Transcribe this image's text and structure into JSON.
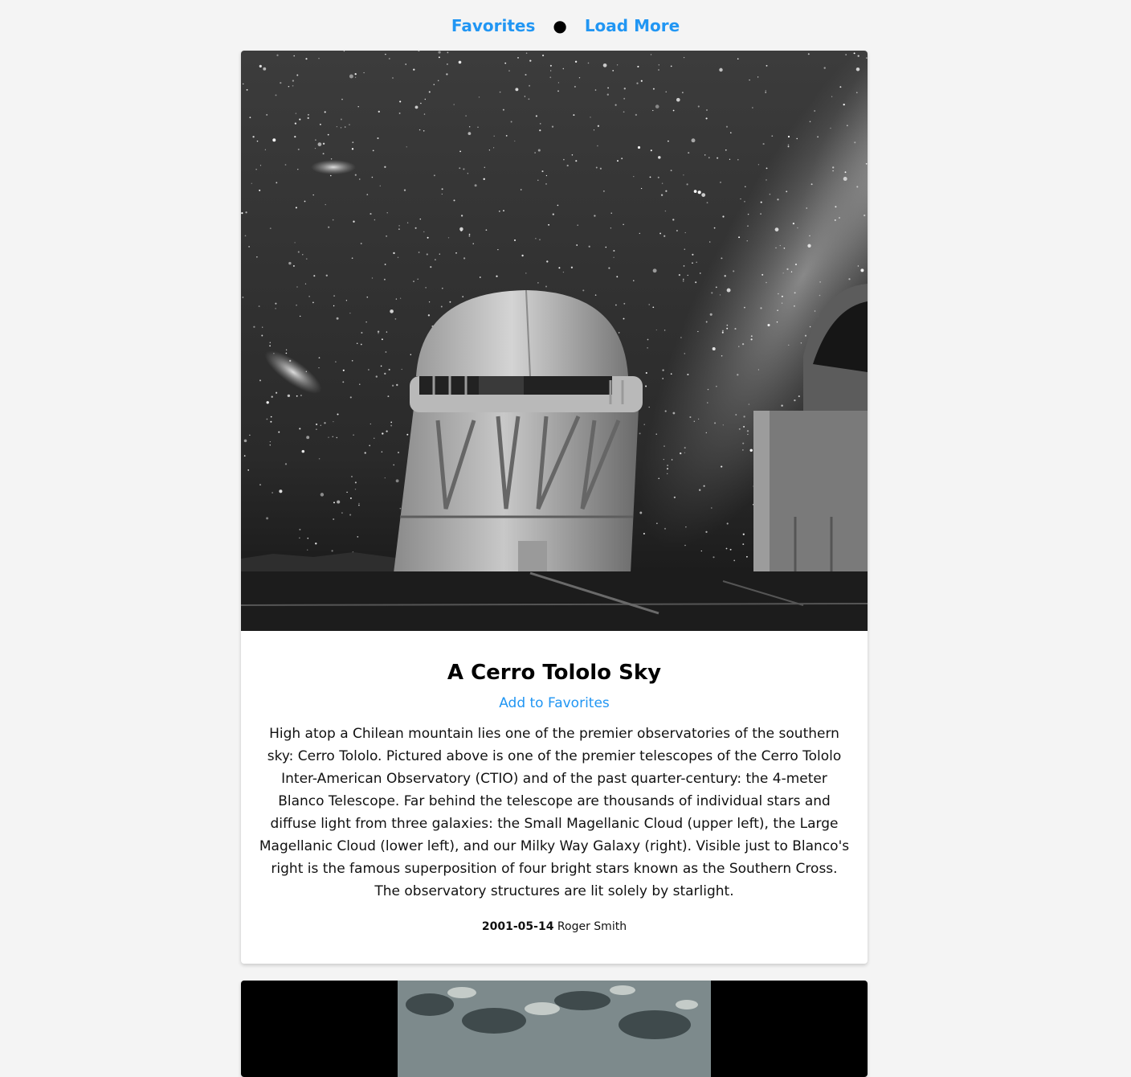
{
  "nav": {
    "favorites_label": "Favorites",
    "separator": "●",
    "load_more_label": "Load More"
  },
  "colors": {
    "link": "#2196f3",
    "background": "#f4f4f4",
    "card": "#ffffff"
  },
  "posts": [
    {
      "title": "A Cerro Tololo Sky",
      "favorite_label": "Add to Favorites",
      "explanation": "High atop a Chilean mountain lies one of the premier observatories of the southern sky: Cerro Tololo. Pictured above is one of the premier telescopes of the Cerro Tololo Inter-American Observatory (CTIO) and of the past quarter-century: the 4-meter Blanco Telescope. Far behind the telescope are thousands of individual stars and diffuse light from three galaxies: the Small Magellanic Cloud (upper left), the Large Magellanic Cloud (lower left), and our Milky Way Galaxy (right). Visible just to Blanco's right is the famous superposition of four bright stars known as the Southern Cross. The observatory structures are lit solely by starlight.",
      "date": "2001-05-14",
      "copyright": "Roger Smith"
    }
  ]
}
